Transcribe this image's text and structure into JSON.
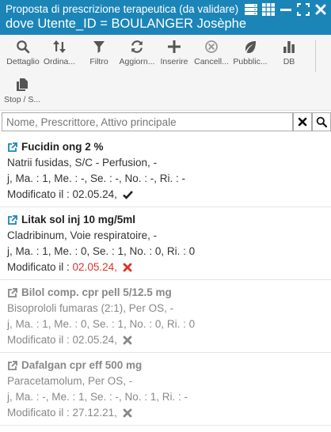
{
  "window": {
    "title": "Proposta di prescrizione terapeutica (da validare)",
    "subtitle": "dove Utente_ID = BOULANGER Josèphe"
  },
  "toolbar": {
    "row1": [
      {
        "label": "Dettaglio",
        "icon": "search-icon"
      },
      {
        "label": "Ordina...",
        "icon": "sort-icon"
      },
      {
        "label": "Filtro",
        "icon": "filter-icon"
      },
      {
        "label": "Aggiorn...",
        "icon": "refresh-icon"
      },
      {
        "label": "Inserire",
        "icon": "plus-icon"
      },
      {
        "label": "Cancell...",
        "icon": "delete-icon"
      },
      {
        "label": "Pubblic...",
        "icon": "leaf-icon"
      },
      {
        "label": "DB",
        "icon": "bar-chart-icon"
      }
    ],
    "row2": [
      {
        "label": "Stop / S...",
        "icon": "copy-icon"
      }
    ]
  },
  "search": {
    "placeholder": "Nome, Prescrittore, Attivo principale",
    "value": ""
  },
  "items": [
    {
      "name": "Fucidin ong 2 %",
      "detail": "Natrii fusidas, S/C - Perfusion, -",
      "dosage": "j, Ma. : 1, Me. : -, Se. : -, No. : -, Ri. : -",
      "modified_label": "Modificato il :",
      "modified_date": "02.05.24,",
      "status": "check-icon",
      "disabled": false
    },
    {
      "name": "Litak sol inj 10 mg/5ml",
      "detail": "Cladribinum, Voie respiratoire, -",
      "dosage": "j, Ma. : 1, Me. : 0, Se. : 1, No. : 0, Ri. : 0",
      "modified_label": "Modificato il :",
      "modified_date": "02.05.24,",
      "status": "cross-icon",
      "disabled": false
    },
    {
      "name": "Bilol comp. cpr pell 5/12.5 mg",
      "detail": "Bisoprololi fumaras (2:1), Per OS, -",
      "dosage": "j, Ma. : 1, Me. : 0, Se. : 1, No. : 0, Ri. : 0",
      "modified_label": "Modificato il :",
      "modified_date": "02.05.24,",
      "status": "cross-icon",
      "disabled": true
    },
    {
      "name": "Dafalgan cpr eff 500 mg",
      "detail": "Paracetamolum, Per OS, -",
      "dosage": "j, Ma. : -, Me. : 1, Se. : -, No. : 1, Ri. : -",
      "modified_label": "Modificato il :",
      "modified_date": "27.12.21,",
      "status": "cross-icon",
      "disabled": true
    }
  ],
  "colors": {
    "titlebar": "#1b85b8",
    "accent": "#1b85b8",
    "rejected": "#d9342b"
  }
}
